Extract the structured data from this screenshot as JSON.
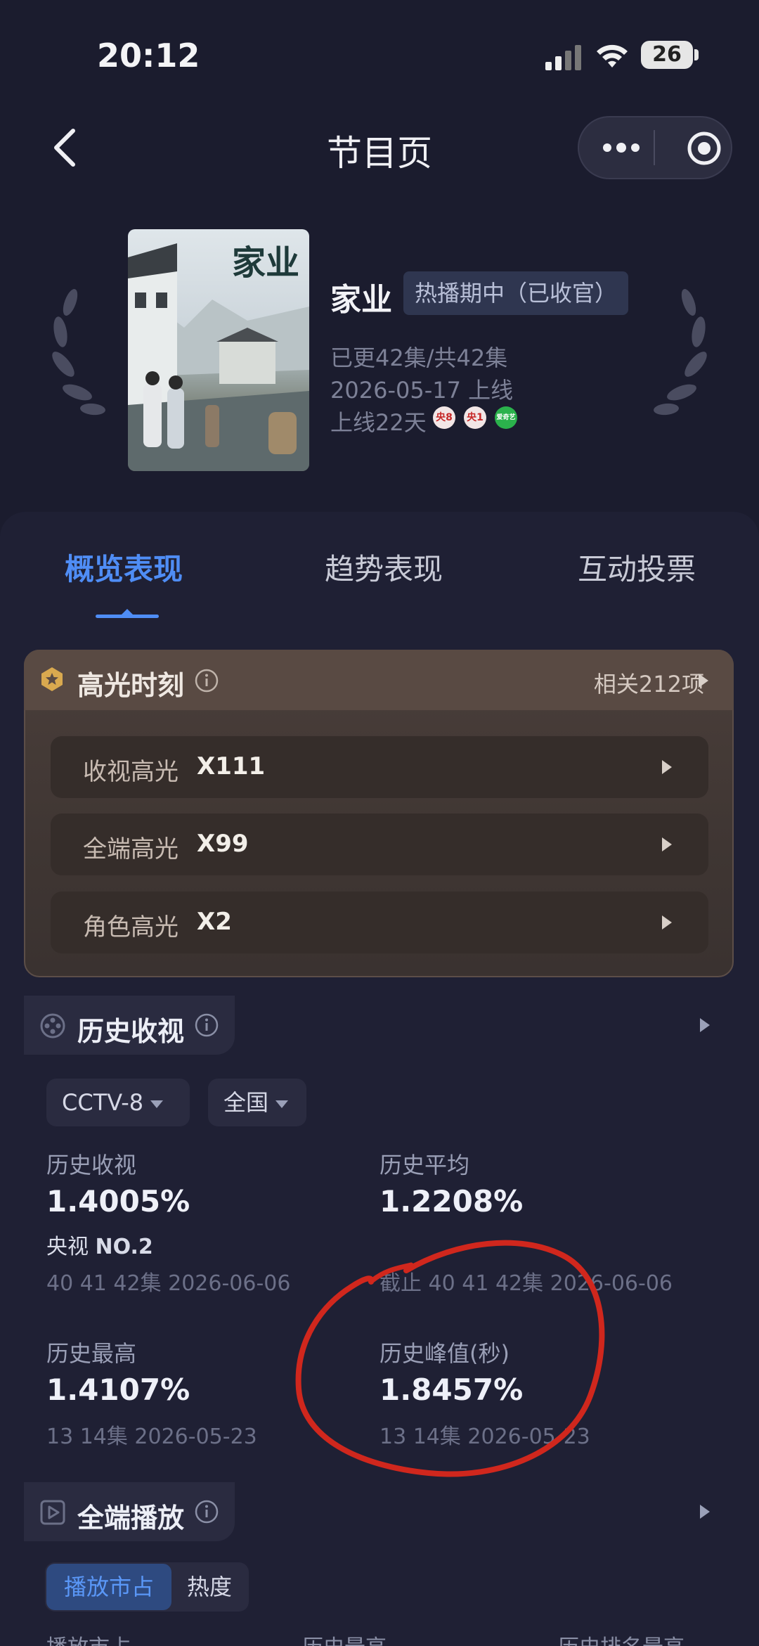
{
  "status_bar": {
    "time": "20:12",
    "battery": "26"
  },
  "nav": {
    "title": "节目页"
  },
  "show": {
    "poster_title": "家业",
    "name": "家业",
    "badge": "热播期中（已收官）",
    "episodes": "已更42集/共42集",
    "premiere": "2026-05-17 上线",
    "days_online": "上线22天",
    "channels": [
      "央8",
      "央1",
      "爱奇艺"
    ]
  },
  "tabs": [
    "概览表现",
    "趋势表现",
    "互动投票"
  ],
  "highlights": {
    "title": "高光时刻",
    "related": "相关212项",
    "rows": [
      {
        "label": "收视高光",
        "value": "X111"
      },
      {
        "label": "全端高光",
        "value": "X99"
      },
      {
        "label": "角色高光",
        "value": "X2"
      }
    ]
  },
  "history": {
    "title": "历史收视",
    "filters": {
      "channel": "CCTV-8",
      "region": "全国"
    },
    "stats": [
      {
        "label": "历史收视",
        "value": "1.4005%",
        "rank_prefix": "央视",
        "rank": "NO.2",
        "sub": "40 41 42集 2026-06-06"
      },
      {
        "label": "历史平均",
        "value": "1.2208%",
        "sub": "截止 40 41 42集 2026-06-06"
      },
      {
        "label": "历史最高",
        "value": "1.4107%",
        "sub": "13 14集 2026-05-23"
      },
      {
        "label": "历史峰值(秒)",
        "value": "1.8457%",
        "sub": "13 14集 2026-05-23"
      }
    ]
  },
  "playback": {
    "title": "全端播放",
    "segments": [
      "播放市占",
      "热度"
    ],
    "columns": [
      "播放市占",
      "历史最高",
      "历史排名最高"
    ]
  },
  "colors": {
    "accent": "#4f8df5",
    "annotation": "#d0271d"
  }
}
